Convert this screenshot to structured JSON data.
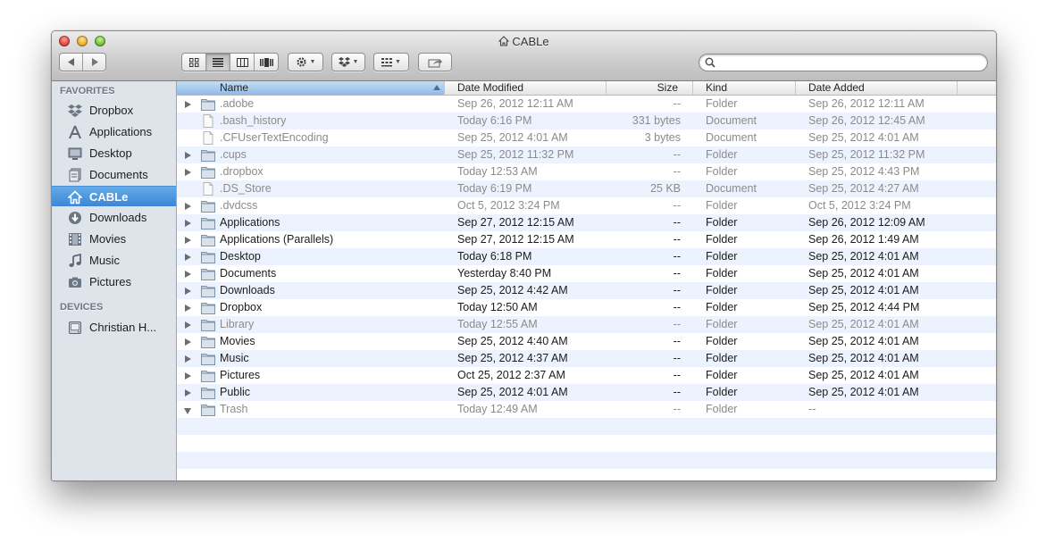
{
  "window": {
    "title": "CABLe",
    "accent": "#3b86d6"
  },
  "search": {
    "placeholder": "",
    "value": ""
  },
  "sidebar": {
    "sections": [
      {
        "header": "FAVORITES",
        "items": [
          {
            "label": "Dropbox",
            "icon": "dropbox-icon"
          },
          {
            "label": "Applications",
            "icon": "applications-icon"
          },
          {
            "label": "Desktop",
            "icon": "desktop-icon"
          },
          {
            "label": "Documents",
            "icon": "documents-icon"
          },
          {
            "label": "CABLe",
            "icon": "home-icon",
            "selected": true
          },
          {
            "label": "Downloads",
            "icon": "downloads-icon"
          },
          {
            "label": "Movies",
            "icon": "movies-icon"
          },
          {
            "label": "Music",
            "icon": "music-icon"
          },
          {
            "label": "Pictures",
            "icon": "pictures-icon"
          }
        ]
      },
      {
        "header": "DEVICES",
        "items": [
          {
            "label": "Christian H...",
            "icon": "hard-drive-icon"
          }
        ]
      }
    ]
  },
  "list": {
    "columns": [
      "Name",
      "Date Modified",
      "Size",
      "Kind",
      "Date Added"
    ],
    "sorted_by": "Name",
    "rows": [
      {
        "name": ".adobe",
        "modified": "Sep 26, 2012 12:11 AM",
        "size": "--",
        "kind": "Folder",
        "added": "Sep 26, 2012 12:11 AM",
        "type": "folder",
        "hidden": true
      },
      {
        "name": ".bash_history",
        "modified": "Today 6:16 PM",
        "size": "331 bytes",
        "kind": "Document",
        "added": "Sep 26, 2012 12:45 AM",
        "type": "document",
        "hidden": true
      },
      {
        "name": ".CFUserTextEncoding",
        "modified": "Sep 25, 2012 4:01 AM",
        "size": "3 bytes",
        "kind": "Document",
        "added": "Sep 25, 2012 4:01 AM",
        "type": "document",
        "hidden": true
      },
      {
        "name": ".cups",
        "modified": "Sep 25, 2012 11:32 PM",
        "size": "--",
        "kind": "Folder",
        "added": "Sep 25, 2012 11:32 PM",
        "type": "folder",
        "hidden": true
      },
      {
        "name": ".dropbox",
        "modified": "Today 12:53 AM",
        "size": "--",
        "kind": "Folder",
        "added": "Sep 25, 2012 4:43 PM",
        "type": "folder",
        "hidden": true
      },
      {
        "name": ".DS_Store",
        "modified": "Today 6:19 PM",
        "size": "25 KB",
        "kind": "Document",
        "added": "Sep 25, 2012 4:27 AM",
        "type": "document",
        "hidden": true
      },
      {
        "name": ".dvdcss",
        "modified": "Oct 5, 2012 3:24 PM",
        "size": "--",
        "kind": "Folder",
        "added": "Oct 5, 2012 3:24 PM",
        "type": "folder",
        "hidden": true
      },
      {
        "name": "Applications",
        "modified": "Sep 27, 2012 12:15 AM",
        "size": "--",
        "kind": "Folder",
        "added": "Sep 26, 2012 12:09 AM",
        "type": "folder",
        "hidden": false
      },
      {
        "name": "Applications (Parallels)",
        "modified": "Sep 27, 2012 12:15 AM",
        "size": "--",
        "kind": "Folder",
        "added": "Sep 26, 2012 1:49 AM",
        "type": "folder",
        "hidden": false
      },
      {
        "name": "Desktop",
        "modified": "Today 6:18 PM",
        "size": "--",
        "kind": "Folder",
        "added": "Sep 25, 2012 4:01 AM",
        "type": "folder",
        "hidden": false
      },
      {
        "name": "Documents",
        "modified": "Yesterday 8:40 PM",
        "size": "--",
        "kind": "Folder",
        "added": "Sep 25, 2012 4:01 AM",
        "type": "folder",
        "hidden": false
      },
      {
        "name": "Downloads",
        "modified": "Sep 25, 2012 4:42 AM",
        "size": "--",
        "kind": "Folder",
        "added": "Sep 25, 2012 4:01 AM",
        "type": "folder",
        "hidden": false
      },
      {
        "name": "Dropbox",
        "modified": "Today 12:50 AM",
        "size": "--",
        "kind": "Folder",
        "added": "Sep 25, 2012 4:44 PM",
        "type": "folder",
        "hidden": false
      },
      {
        "name": "Library",
        "modified": "Today 12:55 AM",
        "size": "--",
        "kind": "Folder",
        "added": "Sep 25, 2012 4:01 AM",
        "type": "folder",
        "hidden": true
      },
      {
        "name": "Movies",
        "modified": "Sep 25, 2012 4:40 AM",
        "size": "--",
        "kind": "Folder",
        "added": "Sep 25, 2012 4:01 AM",
        "type": "folder",
        "hidden": false
      },
      {
        "name": "Music",
        "modified": "Sep 25, 2012 4:37 AM",
        "size": "--",
        "kind": "Folder",
        "added": "Sep 25, 2012 4:01 AM",
        "type": "folder",
        "hidden": false
      },
      {
        "name": "Pictures",
        "modified": "Oct 25, 2012 2:37 AM",
        "size": "--",
        "kind": "Folder",
        "added": "Sep 25, 2012 4:01 AM",
        "type": "folder",
        "hidden": false
      },
      {
        "name": "Public",
        "modified": "Sep 25, 2012 4:01 AM",
        "size": "--",
        "kind": "Folder",
        "added": "Sep 25, 2012 4:01 AM",
        "type": "folder",
        "hidden": false
      },
      {
        "name": "Trash",
        "modified": "Today 12:49 AM",
        "size": "--",
        "kind": "Folder",
        "added": "--",
        "type": "folder",
        "hidden": true,
        "expanded": true
      }
    ]
  }
}
